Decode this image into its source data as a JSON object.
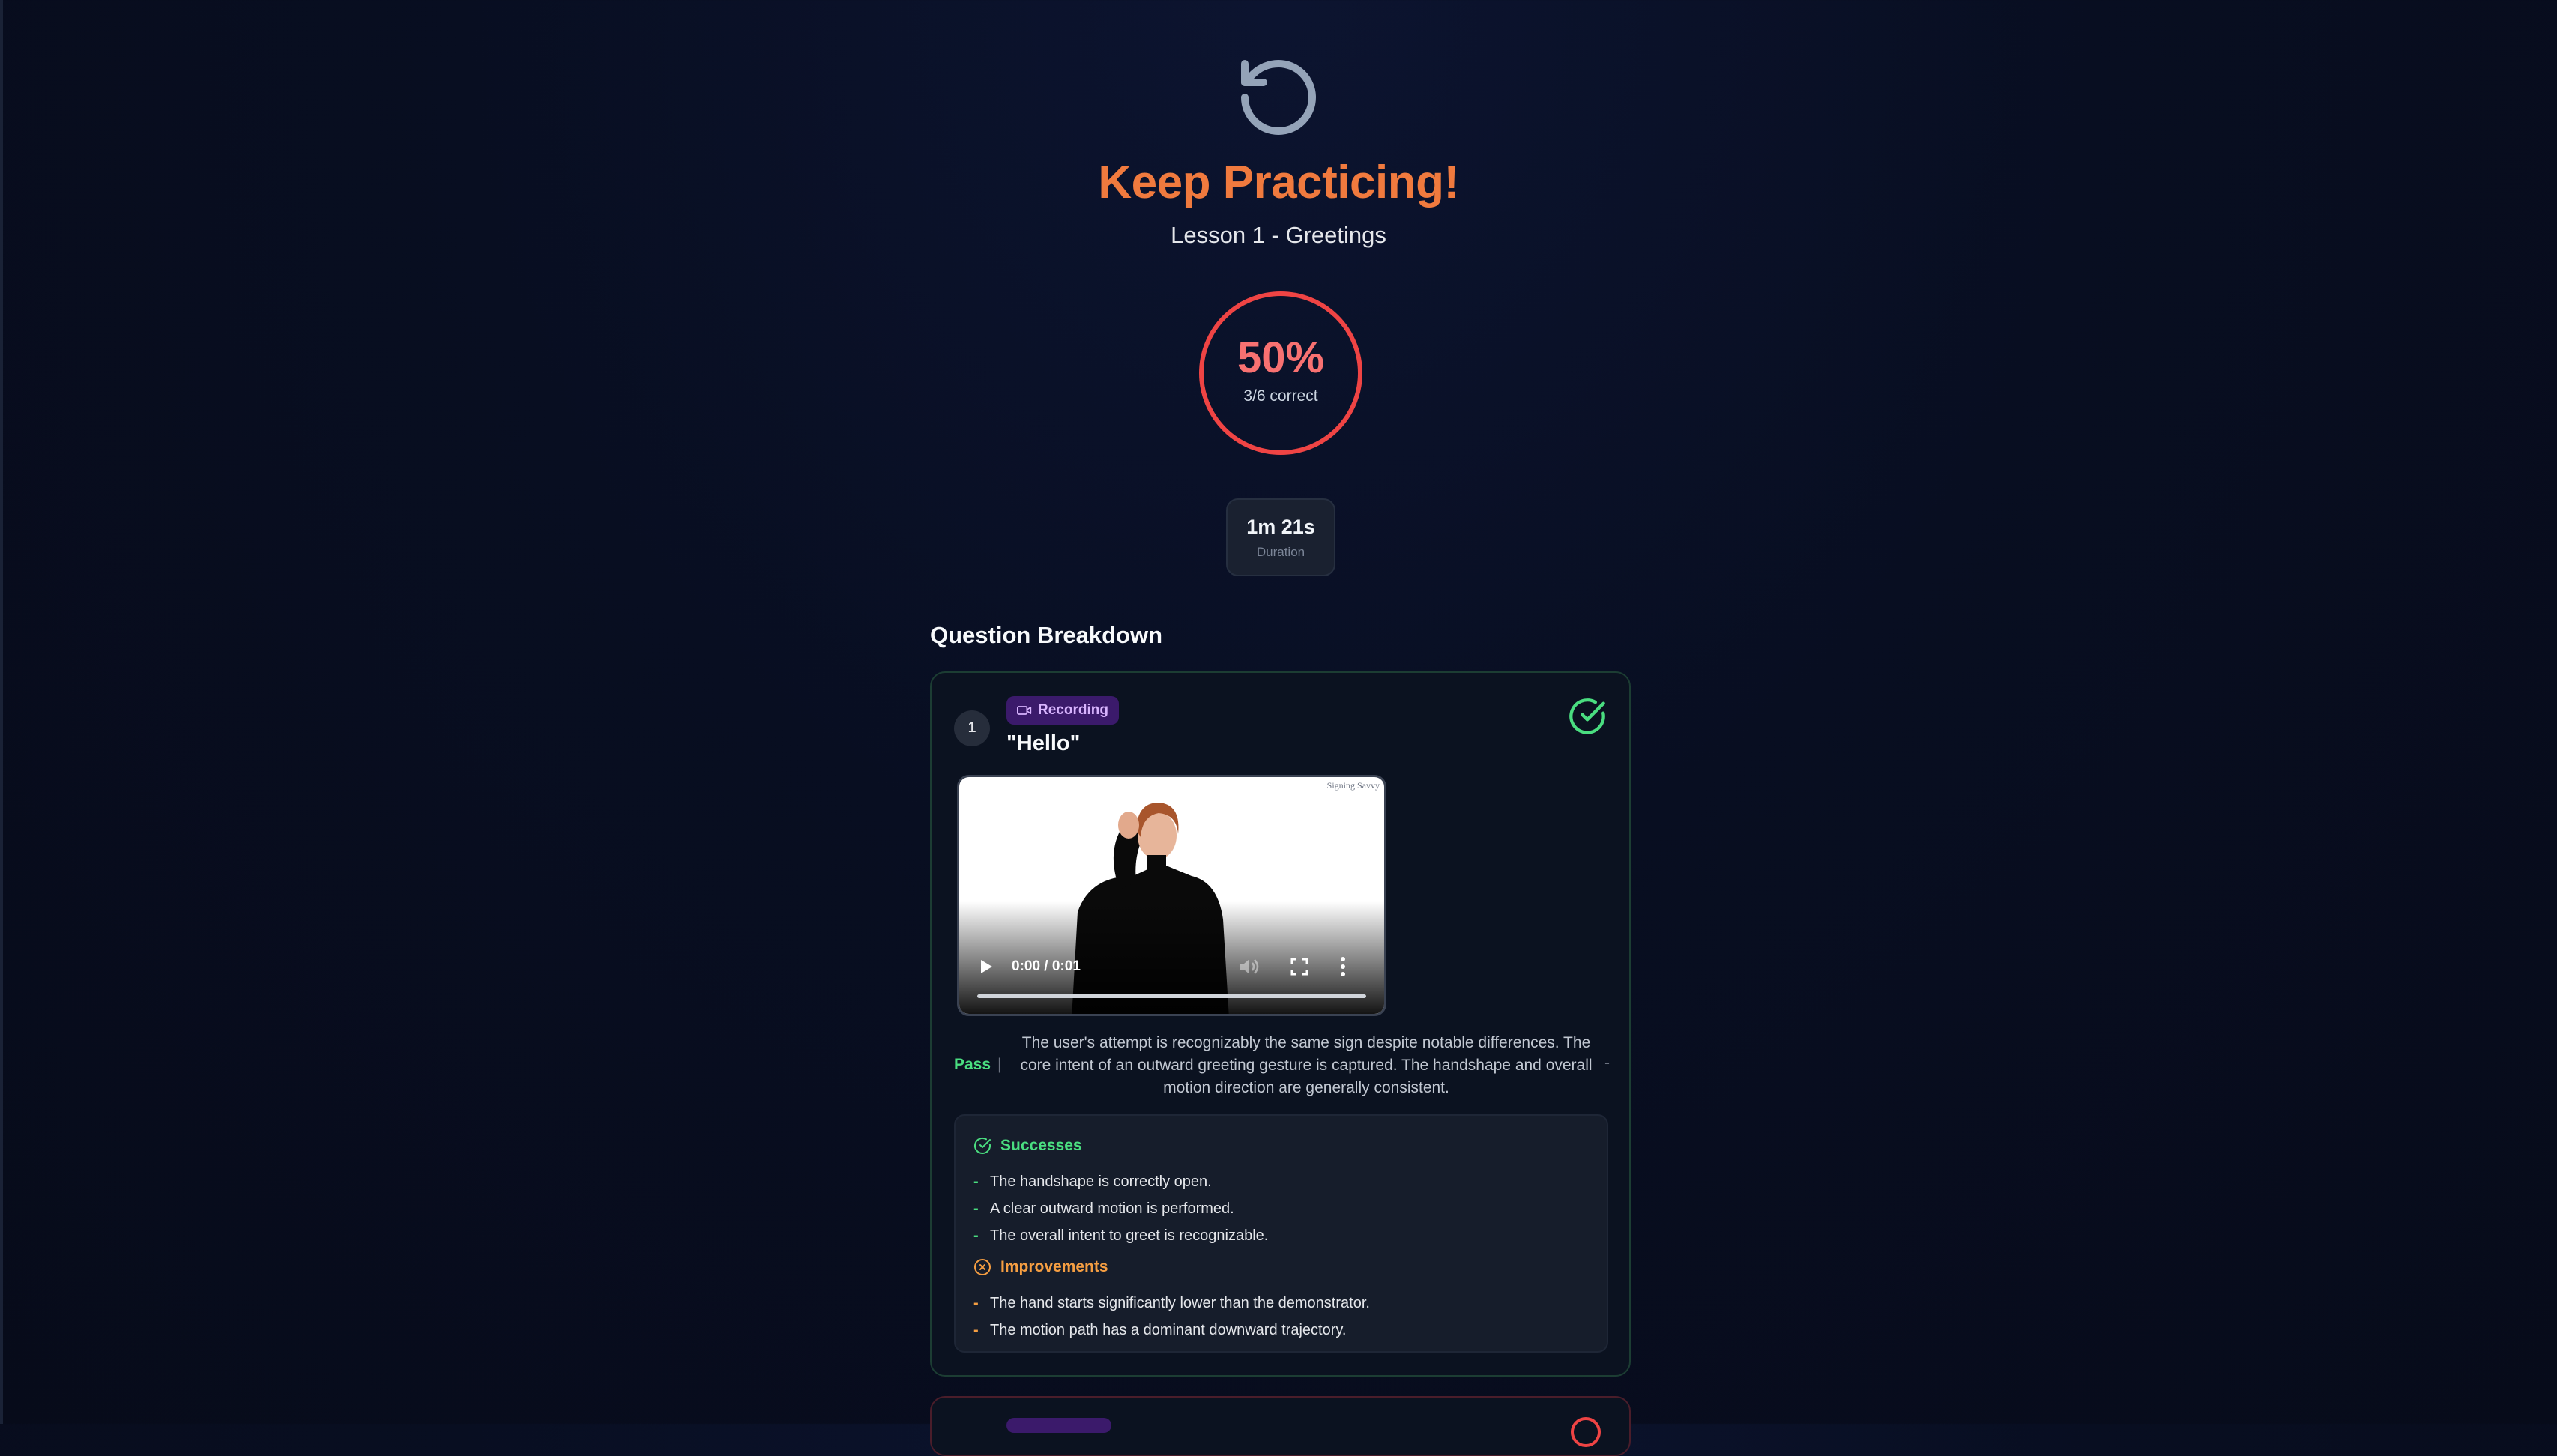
{
  "header": {
    "icon": "retry-icon",
    "title": "Keep Practicing!",
    "subtitle": "Lesson 1 - Greetings"
  },
  "score": {
    "percent_label": "50%",
    "percent": 50,
    "correct_label": "3/6 correct",
    "color": "#ef4444"
  },
  "duration": {
    "value": "1m 21s",
    "label": "Duration"
  },
  "breakdown": {
    "heading": "Question Breakdown",
    "questions": [
      {
        "number": "1",
        "type_badge": "Recording",
        "type_icon": "video-camera-icon",
        "word": "\"Hello\"",
        "status_icon": "check-circle-icon",
        "status_color": "#4ade80",
        "video": {
          "watermark": "Signing Savvy",
          "time": "0:00 / 0:01",
          "progress": 0
        },
        "result": {
          "label": "Pass",
          "separator": "|",
          "explanation": "The user's attempt is recognizably the same sign despite notable differences. The core intent of an outward greeting gesture is captured. The handshape and overall motion direction are generally consistent.",
          "trailing": "-"
        },
        "successes": {
          "title": "Successes",
          "icon": "check-circle-icon",
          "color": "#4ade80",
          "items": [
            "The handshape is correctly open.",
            "A clear outward motion is performed.",
            "The overall intent to greet is recognizable."
          ]
        },
        "improvements": {
          "title": "Improvements",
          "icon": "x-circle-icon",
          "color": "#f59e42",
          "items": [
            "The hand starts significantly lower than the demonstrator.",
            "The motion path has a dominant downward trajectory."
          ]
        }
      }
    ]
  },
  "dash": "-"
}
